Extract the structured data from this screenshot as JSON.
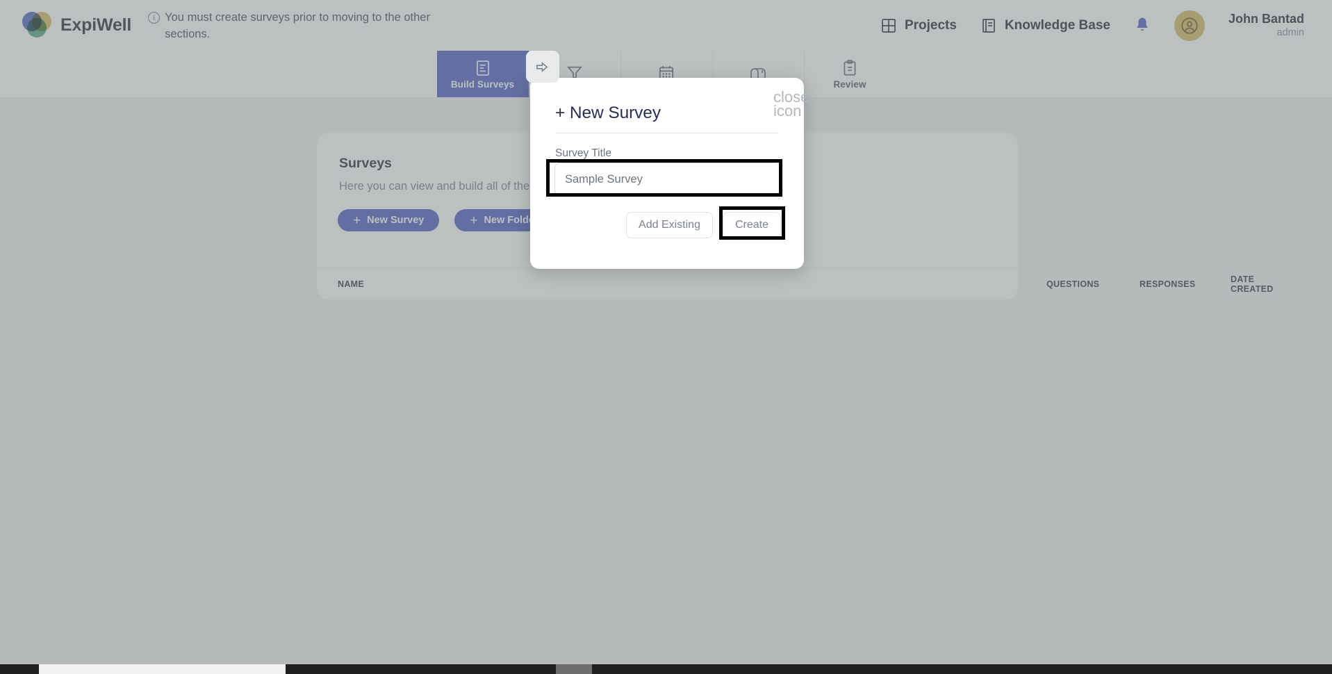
{
  "header": {
    "brand": "ExpiWell",
    "banner_text": "You must create surveys prior to moving to the other sections.",
    "banner_icon": "info-circle-icon",
    "nav_links": [
      {
        "label": "Projects",
        "icon": "grid-icon"
      },
      {
        "label": "Knowledge Base",
        "icon": "book-icon"
      }
    ],
    "notification_icon": "bell-icon",
    "avatar_icon": "user-avatar-icon",
    "user_name": "John Bantad",
    "user_role": "admin"
  },
  "nav_tabs": [
    {
      "label": "Build Surveys",
      "icon": "document-lines-icon",
      "active": true
    },
    {
      "label": "",
      "icon": "funnel-icon",
      "active": false
    },
    {
      "label": "",
      "icon": "calendar-icon",
      "active": false
    },
    {
      "label": "",
      "icon": "mailbox-icon",
      "active": false
    },
    {
      "label": "Review",
      "icon": "clipboard-icon",
      "active": false
    }
  ],
  "tab_badge_icon": "arrow-right-icon",
  "main": {
    "card_title": "Surveys",
    "card_subtitle": "Here you can view and build all of the",
    "new_survey_button": "New Survey",
    "new_folder_button": "New Folder",
    "table_headers": {
      "name": "NAME",
      "questions": "QUESTIONS",
      "responses": "RESPONSES",
      "date_created": "DATE CREATED"
    }
  },
  "modal": {
    "title": "+ New Survey",
    "close_icon": "close-icon",
    "field_label": "Survey Title",
    "input_value": "Sample Survey",
    "input_placeholder": "Sample Survey",
    "add_existing_button": "Add Existing",
    "create_button": "Create"
  },
  "colors": {
    "accent": "#5866c6",
    "avatar": "#d8be6f",
    "bell": "#5566cc",
    "title_navy": "#2b2f50",
    "annotation": "#000000"
  }
}
